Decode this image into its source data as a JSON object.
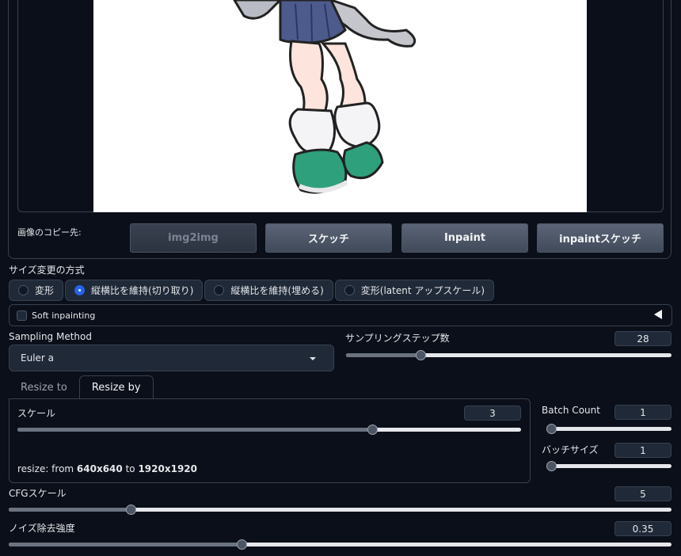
{
  "copy_to": {
    "label": "画像のコピー先:",
    "buttons": [
      "img2img",
      "スケッチ",
      "Inpaint",
      "inpaintスケッチ"
    ]
  },
  "resize_mode": {
    "label": "サイズ変更の方式",
    "options": [
      "変形",
      "縦横比を維持(切り取り)",
      "縦横比を維持(埋める)",
      "変形(latent アップスケール)"
    ],
    "selected_index": 1
  },
  "soft_inpainting": {
    "label": "Soft inpainting",
    "checked": false
  },
  "sampling": {
    "method_label": "Sampling Method",
    "method_value": "Euler a",
    "steps_label": "サンプリングステップ数",
    "steps_value": "28",
    "steps_fraction": 0.22
  },
  "resize_tabs": {
    "tabs": [
      "Resize to",
      "Resize by"
    ],
    "active_index": 1
  },
  "scale": {
    "label": "スケール",
    "value": "3",
    "fraction": 0.71,
    "resize_prefix": "resize: from ",
    "resize_from": "640x640",
    "resize_mid": " to ",
    "resize_to": "1920x1920"
  },
  "batch_count": {
    "label": "Batch Count",
    "value": "1",
    "fraction": 0.0
  },
  "batch_size": {
    "label": "バッチサイズ",
    "value": "1",
    "fraction": 0.0
  },
  "cfg": {
    "label": "CFGスケール",
    "value": "5",
    "fraction": 0.18
  },
  "denoise": {
    "label": "ノイズ除去強度",
    "value": "0.35",
    "fraction": 0.35
  },
  "colors": {
    "accent": "#2563eb",
    "background": "#0b0f19",
    "panel": "#1f2937"
  }
}
